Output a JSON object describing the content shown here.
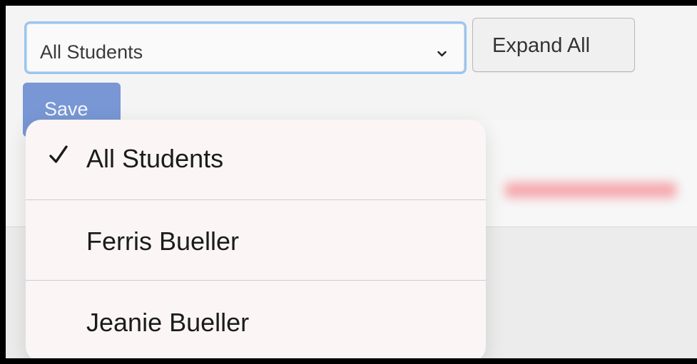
{
  "filter_select": {
    "selected_value": "All Students",
    "icon": "chevron-down-icon"
  },
  "toolbar": {
    "expand_all_label": "Expand All",
    "save_label": "Save"
  },
  "dropdown_menu": {
    "items": [
      {
        "label": "All Students",
        "checked": true
      },
      {
        "label": "Ferris Bueller",
        "checked": false
      },
      {
        "label": "Jeanie Bueller",
        "checked": false
      }
    ],
    "check_icon": "checkmark-icon"
  },
  "colors": {
    "focus_ring": "#9cc5ec",
    "save_button": "#7897d4",
    "menu_background": "#fbf5f6",
    "blurred_accent": "#f4a3a8"
  }
}
